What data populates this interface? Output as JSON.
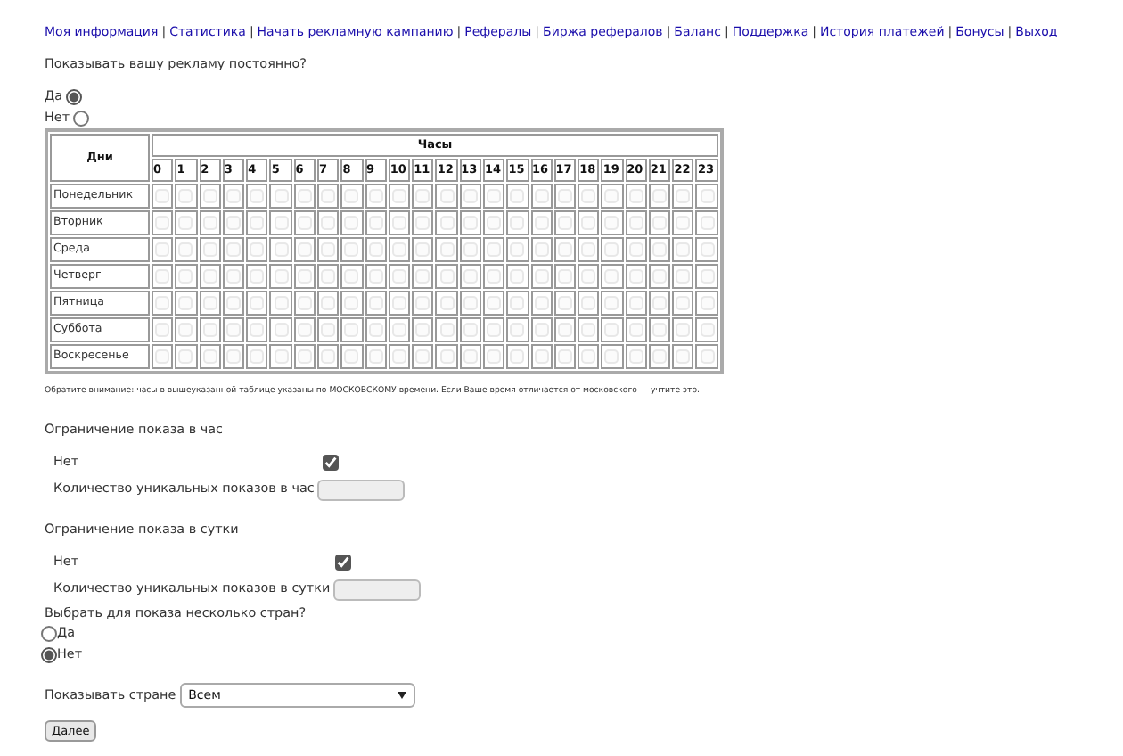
{
  "nav": [
    "Моя информация",
    "Статистика",
    "Начать рекламную кампанию",
    "Рефералы",
    "Биржа рефералов",
    "Баланс",
    "Поддержка",
    "История платежей",
    "Бонусы",
    "Выход"
  ],
  "nav_separator": "|",
  "always_question": "Показывать вашу рекламу постоянно?",
  "always_options": [
    {
      "label": "Да",
      "selected": true
    },
    {
      "label": "Нет",
      "selected": false
    }
  ],
  "schedule": {
    "days_header": "Дни",
    "hours_header": "Часы",
    "disabled": true,
    "hours": [
      "0",
      "1",
      "2",
      "3",
      "4",
      "5",
      "6",
      "7",
      "8",
      "9",
      "10",
      "11",
      "12",
      "13",
      "14",
      "15",
      "16",
      "17",
      "18",
      "19",
      "20",
      "21",
      "22",
      "23"
    ],
    "days": [
      {
        "name": "Понедельник",
        "checked": [
          false,
          false,
          false,
          false,
          false,
          false,
          false,
          false,
          false,
          false,
          false,
          false,
          false,
          false,
          false,
          false,
          false,
          false,
          false,
          false,
          false,
          false,
          false,
          false
        ]
      },
      {
        "name": "Вторник",
        "checked": [
          false,
          false,
          false,
          false,
          false,
          false,
          false,
          false,
          false,
          false,
          false,
          false,
          false,
          false,
          false,
          false,
          false,
          false,
          false,
          false,
          false,
          false,
          false,
          false
        ]
      },
      {
        "name": "Среда",
        "checked": [
          false,
          false,
          false,
          false,
          false,
          false,
          false,
          false,
          false,
          false,
          false,
          false,
          false,
          false,
          false,
          false,
          false,
          false,
          false,
          false,
          false,
          false,
          false,
          false
        ]
      },
      {
        "name": "Четверг",
        "checked": [
          false,
          false,
          false,
          false,
          false,
          false,
          false,
          false,
          false,
          false,
          false,
          false,
          false,
          false,
          false,
          false,
          false,
          false,
          false,
          false,
          false,
          false,
          false,
          false
        ]
      },
      {
        "name": "Пятница",
        "checked": [
          false,
          false,
          false,
          false,
          false,
          false,
          false,
          false,
          false,
          false,
          false,
          false,
          false,
          false,
          false,
          false,
          false,
          false,
          false,
          false,
          false,
          false,
          false,
          false
        ]
      },
      {
        "name": "Суббота",
        "checked": [
          false,
          false,
          false,
          false,
          false,
          false,
          false,
          false,
          false,
          false,
          false,
          false,
          false,
          false,
          false,
          false,
          false,
          false,
          false,
          false,
          false,
          false,
          false,
          false
        ]
      },
      {
        "name": "Воскресенье",
        "checked": [
          false,
          false,
          false,
          false,
          false,
          false,
          false,
          false,
          false,
          false,
          false,
          false,
          false,
          false,
          false,
          false,
          false,
          false,
          false,
          false,
          false,
          false,
          false,
          false
        ]
      }
    ]
  },
  "note": "Обратите внимание: часы в вышеуказанной таблице указаны по МОСКОВСКОМУ времени. Если Ваше время отличается от московского — учтите это.",
  "limits": [
    {
      "title": "Ограничение показа в час",
      "no_label": "Нет",
      "no_checked": true,
      "count_label": "Количество уникальных показов в час",
      "count_disabled": true
    },
    {
      "title": "Ограничение показа в сутки",
      "no_label": "Нет",
      "no_checked": true,
      "count_label": "Количество уникальных показов в сутки",
      "count_disabled": true
    }
  ],
  "countries_question": "Выбрать для показа несколько стран?",
  "countries_options": [
    {
      "label": "Да",
      "selected": false
    },
    {
      "label": "Нет",
      "selected": true
    }
  ],
  "country_label": "Показывать стране",
  "country_select": "Всем",
  "next_button": "Далее"
}
